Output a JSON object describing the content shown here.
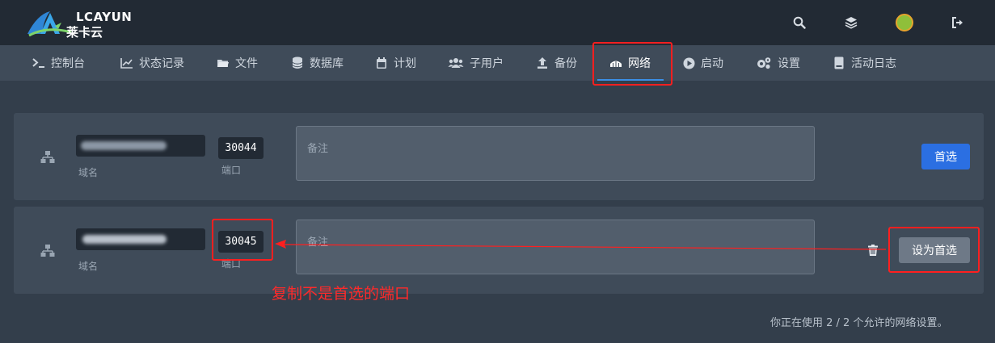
{
  "brand": {
    "name_top": "LCAYUN",
    "name_sub": "莱卡云"
  },
  "header": {
    "icons": [
      "search-icon",
      "layers-icon",
      "avatar",
      "logout-icon"
    ]
  },
  "nav": {
    "items": [
      {
        "label": "控制台",
        "icon": "terminal-icon"
      },
      {
        "label": "状态记录",
        "icon": "chart-icon"
      },
      {
        "label": "文件",
        "icon": "folder-icon"
      },
      {
        "label": "数据库",
        "icon": "database-icon"
      },
      {
        "label": "计划",
        "icon": "calendar-icon"
      },
      {
        "label": "子用户",
        "icon": "users-icon"
      },
      {
        "label": "备份",
        "icon": "upload-icon"
      },
      {
        "label": "网络",
        "icon": "network-icon",
        "active": true
      },
      {
        "label": "启动",
        "icon": "play-icon"
      },
      {
        "label": "设置",
        "icon": "cogs-icon"
      },
      {
        "label": "活动日志",
        "icon": "log-icon"
      }
    ]
  },
  "allocations": [
    {
      "domain_label": "域名",
      "port": "30044",
      "port_label": "端口",
      "notes_placeholder": "备注",
      "button_label": "首选"
    },
    {
      "domain_label": "域名",
      "port": "30045",
      "port_label": "端口",
      "notes_placeholder": "备注",
      "button_label": "设为首选"
    }
  ],
  "annotation": {
    "text": "复制不是首选的端口",
    "color": "#ff2a2a"
  },
  "footer": {
    "text": "你正在使用 2 / 2 个允许的网络设置。"
  },
  "colors": {
    "accent": "#2b6fe2",
    "nav_active_underline": "#3b8fe6",
    "annotation_red": "#ff1f1f"
  }
}
